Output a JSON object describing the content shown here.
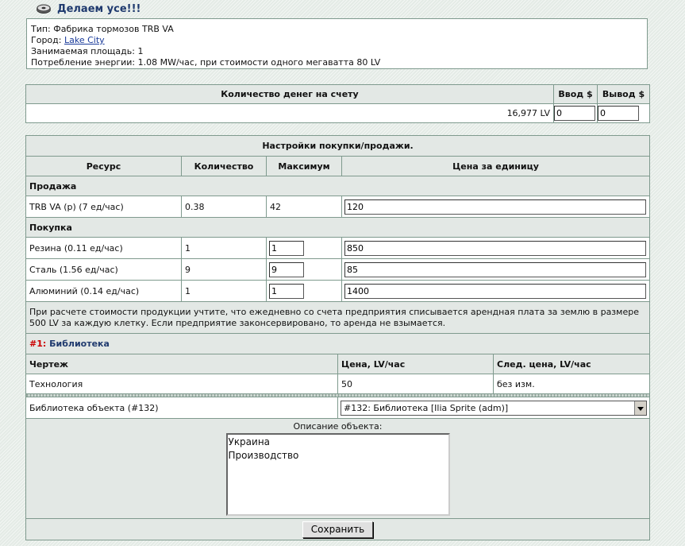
{
  "header": {
    "title": "Делаем усе!!!"
  },
  "info": {
    "type_label": "Тип:",
    "type_value": "Фабрика тормозов TRB VA",
    "city_label": "Город:",
    "city_value": "Lake City",
    "area_label": "Занимаемая площадь:",
    "area_value": "1",
    "energy_text": "Потребление энергии: 1.08 MW/час, при стоимости одного мегаватта 80 LV"
  },
  "money": {
    "header": "Количество денег на счету",
    "deposit_label": "Ввод $",
    "withdraw_label": "Вывод $",
    "balance": "16,977 LV",
    "deposit_value": "0",
    "withdraw_value": "0"
  },
  "trade": {
    "title": "Настройки покупки/продажи.",
    "columns": [
      "Ресурс",
      "Количество",
      "Максимум",
      "Цена за единицу"
    ],
    "sell_label": "Продажа",
    "sell_rows": [
      {
        "resource": "TRB VA (р) (7 ед/час)",
        "qty": "0.38",
        "max": "42",
        "price": "120"
      }
    ],
    "buy_label": "Покупка",
    "buy_rows": [
      {
        "resource": "Резина (0.11 ед/час)",
        "qty": "1",
        "max": "1",
        "price": "850"
      },
      {
        "resource": "Сталь (1.56 ед/час)",
        "qty": "9",
        "max": "9",
        "price": "85"
      },
      {
        "resource": "Алюминий (0.14 ед/час)",
        "qty": "1",
        "max": "1",
        "price": "1400"
      }
    ],
    "note": "При расчете стоимости продукции учтите, что ежедневно со счета предприятия списывается арендная плата за землю в размере 500 LV за каждую клетку. Если предприятие законсервировано, то аренда не взымается."
  },
  "library": {
    "number": "#1:",
    "title": "Библиотека",
    "columns": [
      "Чертеж",
      "Цена, LV/час",
      "След. цена, LV/час"
    ],
    "rows": [
      {
        "name": "Технология",
        "price": "50",
        "next": "без изм."
      }
    ],
    "object_label": "Библиотека объекта (#132)",
    "object_selected": "#132: Библиотека [Ilia Sprite (adm)]",
    "desc_label": "Описание объекта:",
    "desc_line1": "Украина",
    "desc_line2": "Производство",
    "save_label": "Сохранить"
  }
}
